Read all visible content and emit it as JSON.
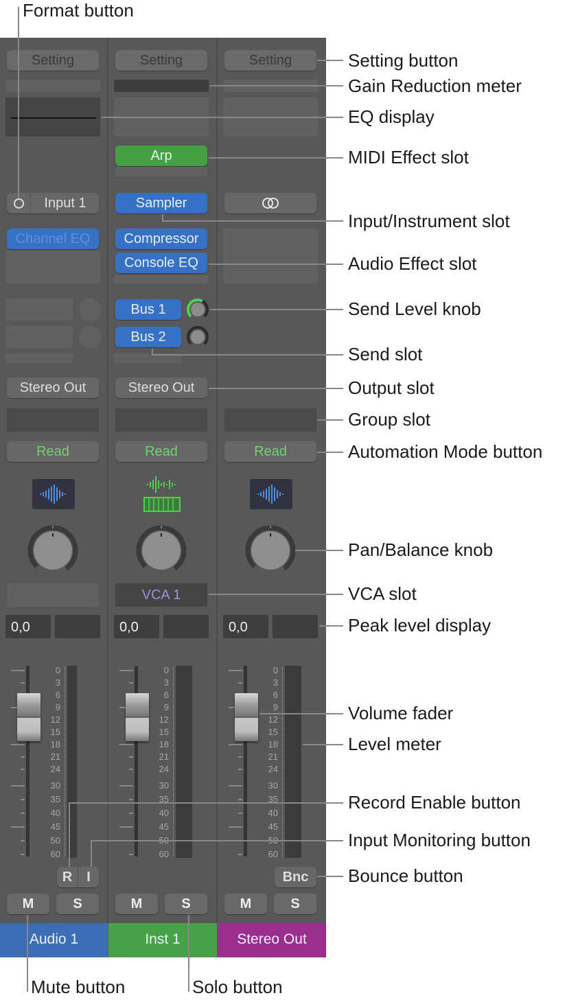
{
  "callouts": {
    "format_button": "Format button",
    "setting_button": "Setting button",
    "gain_reduction": "Gain Reduction meter",
    "eq_display": "EQ display",
    "midi_effect": "MIDI Effect slot",
    "input_instrument": "Input/Instrument slot",
    "audio_effect": "Audio Effect slot",
    "send_level": "Send Level knob",
    "send_slot": "Send slot",
    "output_slot": "Output slot",
    "group_slot": "Group slot",
    "automation_mode": "Automation Mode button",
    "pan_knob": "Pan/Balance knob",
    "vca_slot": "VCA slot",
    "peak_display": "Peak level display",
    "volume_fader": "Volume fader",
    "level_meter": "Level meter",
    "record_enable": "Record Enable button",
    "input_monitoring": "Input Monitoring button",
    "bounce": "Bounce button",
    "mute": "Mute button",
    "solo": "Solo button"
  },
  "meter_scale": [
    "0",
    "3",
    "6",
    "9",
    "12",
    "15",
    "18",
    "21",
    "24",
    "30",
    "35",
    "40",
    "45",
    "50",
    "60"
  ],
  "strips": [
    {
      "name": "Audio 1",
      "color": "#3a6fb5",
      "setting": "Setting",
      "format_icon": "mono-circle-icon",
      "input": "Input 1",
      "audio_effects": [
        "Channel EQ"
      ],
      "output": "Stereo Out",
      "automation": "Read",
      "icon": "audio-waveform-icon",
      "peak": "0,0",
      "record": "R",
      "monitor": "I",
      "mute": "M",
      "solo": "S",
      "fader_db": 0,
      "pan": 0
    },
    {
      "name": "Inst 1",
      "color": "#47a146",
      "setting": "Setting",
      "midi_effect": "Arp",
      "instrument": "Sampler",
      "audio_effects": [
        "Compressor",
        "Console EQ"
      ],
      "sends": [
        {
          "label": "Bus 1",
          "level": 0.6
        },
        {
          "label": "Bus 2",
          "level": 0
        }
      ],
      "output": "Stereo Out",
      "automation": "Read",
      "icon": "instrument-keyboard-icon",
      "vca": "VCA 1",
      "peak": "0,0",
      "mute": "M",
      "solo": "S",
      "fader_db": 0,
      "pan": 0
    },
    {
      "name": "Stereo Out",
      "color": "#9b2d8f",
      "setting": "Setting",
      "format_icon": "stereo-link-icon",
      "automation": "Read",
      "icon": "audio-waveform-icon",
      "peak": "0,0",
      "bounce": "Bnc",
      "mute": "M",
      "solo": "S",
      "fader_db": 0,
      "pan": 0
    }
  ]
}
